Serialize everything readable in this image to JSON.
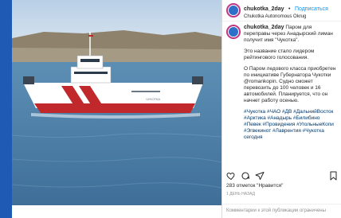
{
  "post": {
    "username": "chukotka_2day",
    "follow_label": "Подписаться",
    "separator": "•",
    "location": "Chukotka Autonomous Okrug",
    "caption_user": "chukotka_2day",
    "caption_p1": "Паром для переправы через Анадырский лиман получит имя \"Чукотка\".",
    "caption_p2": "Это название стало лидером рейтингового голосования.",
    "caption_p3": "О Паром ледового класса приобретен по инициативе Губернатора Чукотки @romankopin. Судно сможет перевозить до 100 человек и 16 автомобилей. Планируется, что он начнет работу осенью.",
    "hashtags": "#Чукотка #ЧАО #ДВ #ДальнийВосток #Арктика #Анадырь #Билибино #Певек #Провидения #УгольныеКопи #Эгвекинот #Лаврентия #Чукотка сегодня",
    "likes": "283 отметок \"Нравится\"",
    "date": "1 ДЕНЬ НАЗАД",
    "comments_off": "Комментарии к этой публикации ограничены",
    "ship_name": "ЧУКОТКА"
  },
  "colors": {
    "brand_blue": "#1f5bb5",
    "link_blue": "#0095f6",
    "hashtag_blue": "#00376b",
    "hull_red": "#c0282b"
  },
  "icons": [
    "heart-icon",
    "comment-icon",
    "share-icon",
    "bookmark-icon"
  ]
}
